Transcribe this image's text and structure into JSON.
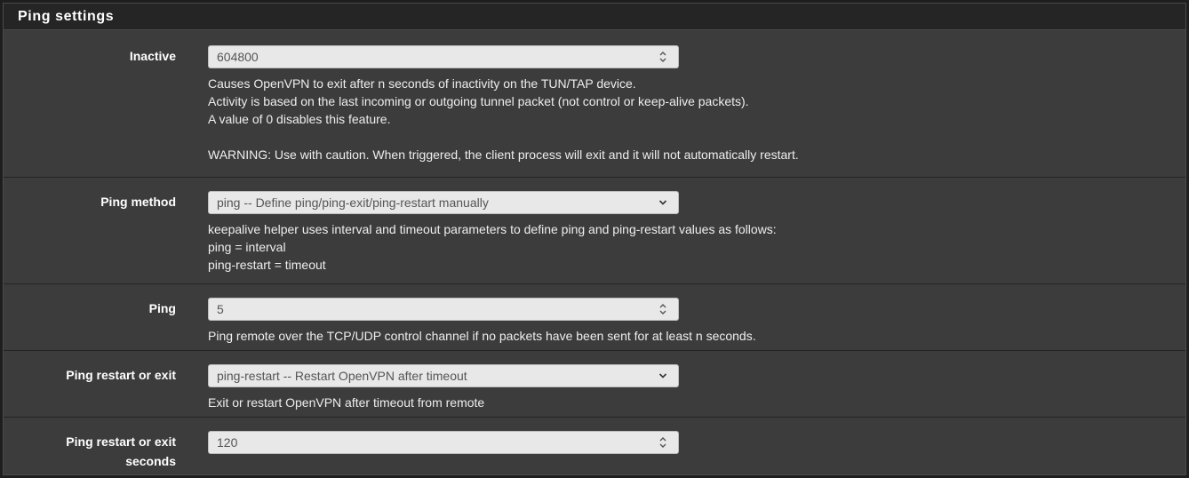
{
  "panel": {
    "title": "Ping settings"
  },
  "inactive": {
    "label": "Inactive",
    "value": "604800",
    "help": [
      "Causes OpenVPN to exit after n seconds of inactivity on the TUN/TAP device.",
      "Activity is based on the last incoming or outgoing tunnel packet (not control or keep-alive packets).",
      "A value of 0 disables this feature.",
      "",
      "WARNING: Use with caution. When triggered, the client process will exit and it will not automatically restart."
    ]
  },
  "ping_method": {
    "label": "Ping method",
    "selected": "ping -- Define ping/ping-exit/ping-restart manually",
    "help": [
      "keepalive helper uses interval and timeout parameters to define ping and ping-restart values as follows:",
      "ping = interval",
      "ping-restart = timeout"
    ]
  },
  "ping": {
    "label": "Ping",
    "value": "5",
    "help": [
      "Ping remote over the TCP/UDP control channel if no packets have been sent for at least n seconds."
    ]
  },
  "ping_action": {
    "label": "Ping restart or exit",
    "selected": "ping-restart -- Restart OpenVPN after timeout",
    "help": [
      "Exit or restart OpenVPN after timeout from remote"
    ]
  },
  "ping_action_seconds": {
    "label_line1": "Ping restart or exit",
    "label_line2": "seconds",
    "value": "120"
  },
  "icons": {
    "spinner": "spinner-arrows-icon",
    "dropdown": "chevron-down-icon"
  }
}
